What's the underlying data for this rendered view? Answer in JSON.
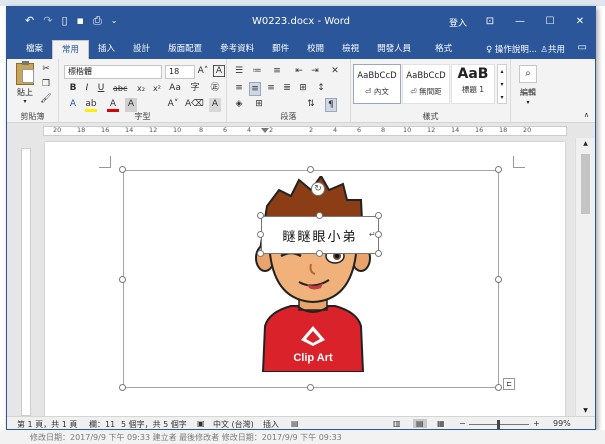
{
  "behind": {
    "top_text": "",
    "bottom_text": "修改日期：2017/9/9 下午 09:33    建立者   最後修改者    修改日期：2017/9/9 下午 09:33"
  },
  "titlebar": {
    "title": "W0223.docx - Word",
    "login": "登入",
    "qat": [
      {
        "name": "undo-icon",
        "glyph": "↶"
      },
      {
        "name": "redo-icon",
        "glyph": "↷"
      },
      {
        "name": "new-doc-icon",
        "glyph": "▯"
      },
      {
        "name": "save-icon",
        "glyph": "▪"
      },
      {
        "name": "print-icon",
        "glyph": "⎙"
      },
      {
        "name": "customize-icon",
        "glyph": "⌄"
      }
    ]
  },
  "tabs": [
    {
      "label": "檔案",
      "active": false
    },
    {
      "label": "常用",
      "active": true
    },
    {
      "label": "插入",
      "active": false
    },
    {
      "label": "設計",
      "active": false
    },
    {
      "label": "版面配置",
      "active": false
    },
    {
      "label": "參考資料",
      "active": false
    },
    {
      "label": "郵件",
      "active": false
    },
    {
      "label": "校閱",
      "active": false
    },
    {
      "label": "檢視",
      "active": false
    },
    {
      "label": "開發人員",
      "active": false
    },
    {
      "label": "格式",
      "active": false
    }
  ],
  "tellme": "操作說明...",
  "share": "共用",
  "ribbon": {
    "clipboard": {
      "paste": "貼上",
      "label": "剪貼簿"
    },
    "font": {
      "family": "標楷體",
      "size": "18",
      "label": "字型"
    },
    "paragraph": {
      "label": "段落"
    },
    "styles": {
      "label": "樣式",
      "items": [
        {
          "sample": "AaBbCcD",
          "name": "⏎ 內文"
        },
        {
          "sample": "AaBbCcD",
          "name": "⏎ 無間距"
        },
        {
          "sample": "AaB",
          "name": "標題 1"
        }
      ]
    },
    "editing": {
      "label": "編輯"
    }
  },
  "ruler": {
    "numbers": [
      "20",
      "18",
      "16",
      "14",
      "12",
      "10",
      "8",
      "6",
      "4",
      "2",
      "2",
      "4",
      "6",
      "8",
      "10",
      "12",
      "14",
      "16",
      "18",
      "20"
    ]
  },
  "document": {
    "textbox_text": "瞇瞇眼小弟",
    "clipart_label": "Clip Art"
  },
  "statusbar": {
    "page": "第 1 頁，共 1 頁",
    "section": "欄：11",
    "words": "5 個字，共 5 個字",
    "language": "中文 (台灣)",
    "mode": "插入",
    "zoom": "99%"
  },
  "colors": {
    "word_blue": "#2b579a",
    "shirt_red": "#d9222a"
  }
}
